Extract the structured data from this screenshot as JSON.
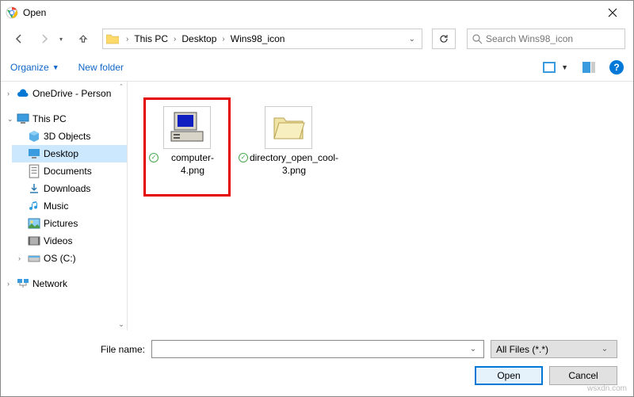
{
  "window": {
    "title": "Open"
  },
  "breadcrumb": {
    "root": "This PC",
    "mid": "Desktop",
    "leaf": "Wins98_icon"
  },
  "search": {
    "placeholder": "Search Wins98_icon"
  },
  "toolbar": {
    "organize": "Organize",
    "newfolder": "New folder"
  },
  "tree": {
    "onedrive": "OneDrive - Person",
    "thispc": "This PC",
    "objects3d": "3D Objects",
    "desktop": "Desktop",
    "documents": "Documents",
    "downloads": "Downloads",
    "music": "Music",
    "pictures": "Pictures",
    "videos": "Videos",
    "osdrive": "OS (C:)",
    "network": "Network"
  },
  "files": {
    "f1": "computer-4.png",
    "f2": "directory_open_cool-3.png"
  },
  "footer": {
    "filename_label": "File name:",
    "filename_value": "",
    "filter": "All Files (*.*)",
    "open": "Open",
    "cancel": "Cancel"
  },
  "watermark": "wsxdn.com"
}
